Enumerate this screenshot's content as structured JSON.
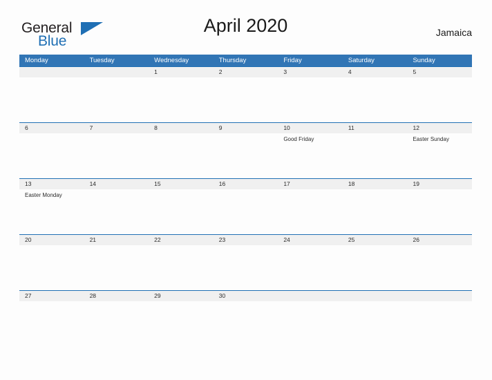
{
  "brand": {
    "word_one": "General",
    "word_two": "Blue",
    "accent_color": "#1f6fb4",
    "triangle_icon": "triangle-icon"
  },
  "header": {
    "title": "April 2020",
    "country": "Jamaica",
    "header_band_color": "#3175b5"
  },
  "calendar": {
    "weekdays": [
      "Monday",
      "Tuesday",
      "Wednesday",
      "Thursday",
      "Friday",
      "Saturday",
      "Sunday"
    ],
    "weeks": [
      {
        "days": [
          {
            "date": "",
            "event": ""
          },
          {
            "date": "",
            "event": ""
          },
          {
            "date": "1",
            "event": ""
          },
          {
            "date": "2",
            "event": ""
          },
          {
            "date": "3",
            "event": ""
          },
          {
            "date": "4",
            "event": ""
          },
          {
            "date": "5",
            "event": ""
          }
        ]
      },
      {
        "days": [
          {
            "date": "6",
            "event": ""
          },
          {
            "date": "7",
            "event": ""
          },
          {
            "date": "8",
            "event": ""
          },
          {
            "date": "9",
            "event": ""
          },
          {
            "date": "10",
            "event": "Good Friday"
          },
          {
            "date": "11",
            "event": ""
          },
          {
            "date": "12",
            "event": "Easter Sunday"
          }
        ]
      },
      {
        "days": [
          {
            "date": "13",
            "event": "Easter Monday"
          },
          {
            "date": "14",
            "event": ""
          },
          {
            "date": "15",
            "event": ""
          },
          {
            "date": "16",
            "event": ""
          },
          {
            "date": "17",
            "event": ""
          },
          {
            "date": "18",
            "event": ""
          },
          {
            "date": "19",
            "event": ""
          }
        ]
      },
      {
        "days": [
          {
            "date": "20",
            "event": ""
          },
          {
            "date": "21",
            "event": ""
          },
          {
            "date": "22",
            "event": ""
          },
          {
            "date": "23",
            "event": ""
          },
          {
            "date": "24",
            "event": ""
          },
          {
            "date": "25",
            "event": ""
          },
          {
            "date": "26",
            "event": ""
          }
        ]
      },
      {
        "days": [
          {
            "date": "27",
            "event": ""
          },
          {
            "date": "28",
            "event": ""
          },
          {
            "date": "29",
            "event": ""
          },
          {
            "date": "30",
            "event": ""
          },
          {
            "date": "",
            "event": ""
          },
          {
            "date": "",
            "event": ""
          },
          {
            "date": "",
            "event": ""
          }
        ]
      }
    ]
  }
}
